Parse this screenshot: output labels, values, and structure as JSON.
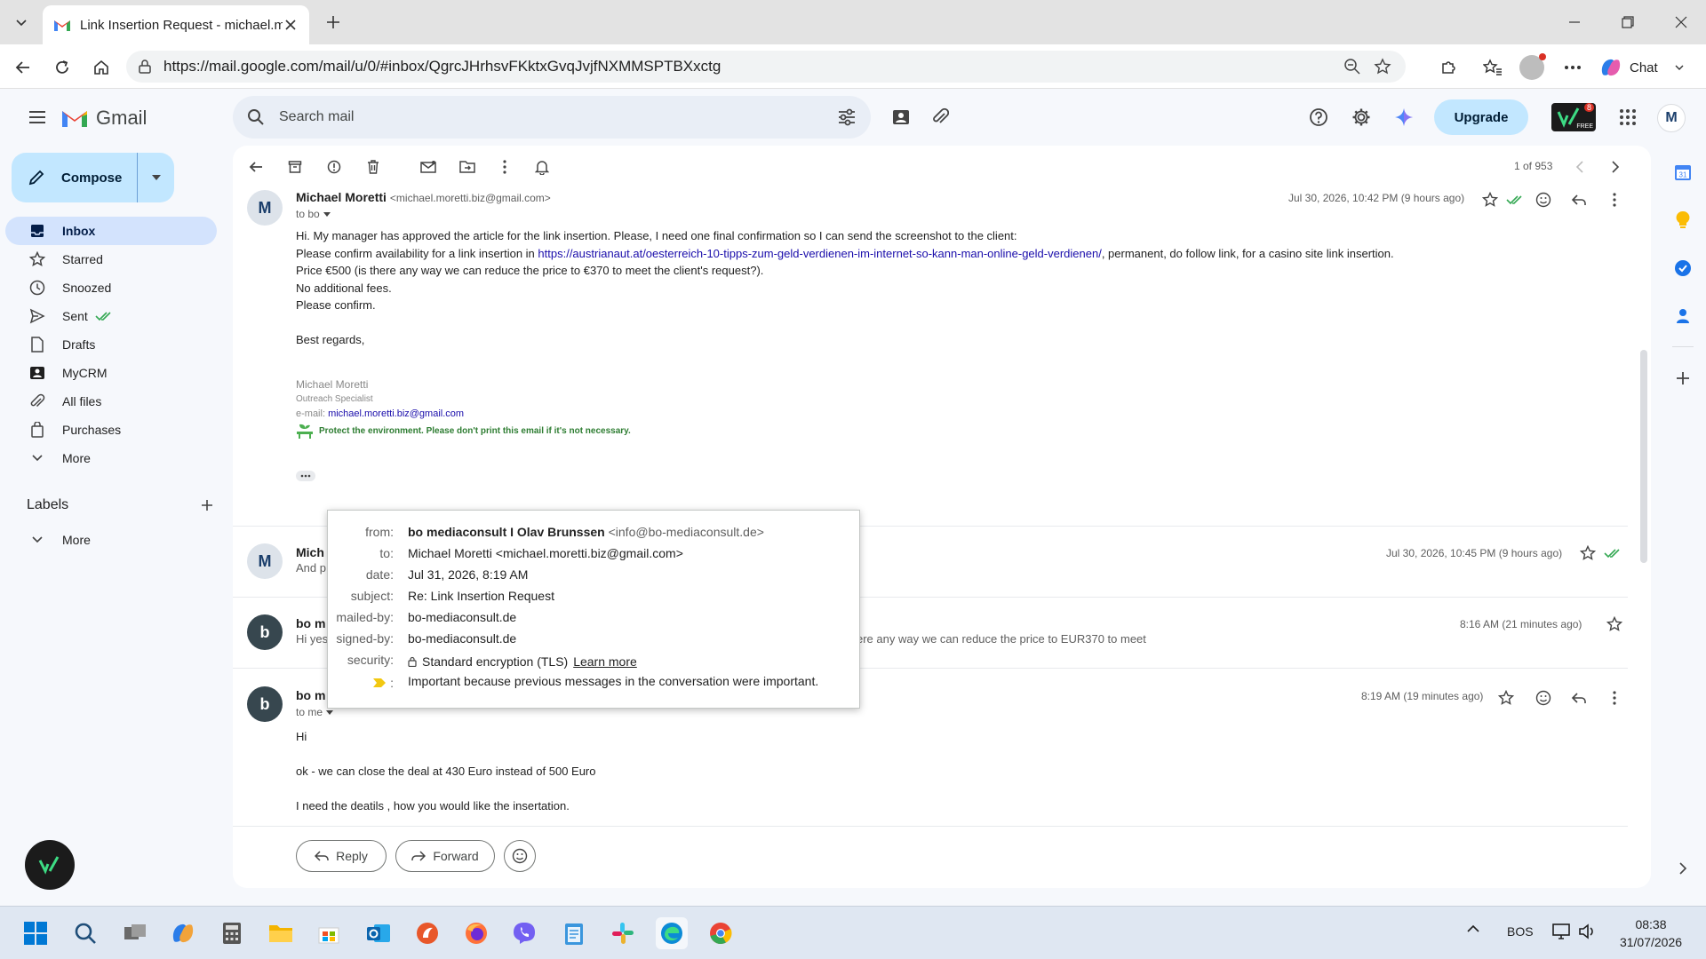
{
  "browser": {
    "tab_title": "Link Insertion Request - michael.m",
    "url": "https://mail.google.com/mail/u/0/#inbox/QgrcJHrhsvFKktxGvqJvjfNXMMSPTBXxctg",
    "chat_label": "Chat"
  },
  "gmail": {
    "brand": "Gmail",
    "search_placeholder": "Search mail",
    "upgrade_label": "Upgrade",
    "ext_badge_count": "8",
    "ext_badge_free": "FREE",
    "account_initial": "M"
  },
  "sidebar": {
    "compose_label": "Compose",
    "items": [
      {
        "label": "Inbox",
        "icon": "inbox-icon"
      },
      {
        "label": "Starred",
        "icon": "star-icon"
      },
      {
        "label": "Snoozed",
        "icon": "clock-icon"
      },
      {
        "label": "Sent",
        "icon": "send-icon"
      },
      {
        "label": "Drafts",
        "icon": "draft-icon"
      },
      {
        "label": "MyCRM",
        "icon": "contact-icon"
      },
      {
        "label": "All files",
        "icon": "paperclip-icon"
      },
      {
        "label": "Purchases",
        "icon": "bag-icon"
      },
      {
        "label": "More",
        "icon": "chevron-down-icon"
      }
    ],
    "labels_heading": "Labels",
    "labels_more": "More"
  },
  "toolbar": {
    "pager": "1 of 953"
  },
  "messages": {
    "m1": {
      "avatar": "M",
      "sender": "Michael Moretti",
      "email": "<michael.moretti.biz@gmail.com>",
      "to": "to bo",
      "date": "Jul 30, 2026, 10:42 PM (9 hours ago)",
      "line1": "Hi. My manager has approved the article for the link insertion. Please, I need one final confirmation so I can send the screenshot to the client:",
      "line2_pre": "Please confirm availability for a link insertion in ",
      "line2_link": "https://austrianaut.at/oesterreich-10-tipps-zum-geld-verdienen-im-internet-so-kann-man-online-geld-verdienen/",
      "line2_post": ", permanent, do follow link, for a casino site link insertion.",
      "line3": "Price  €500 (is there any way we can reduce the price to €370 to meet the client's request?).",
      "line4": "No additional fees.",
      "line5": "Please confirm.",
      "line6": "Best regards,",
      "sig_name": "Michael Moretti",
      "sig_title": "Outreach Specialist",
      "sig_email_label": "e-mail: ",
      "sig_email": "michael.moretti.biz@gmail.com",
      "sig_env": "Protect the environment. Please don't print this email if it's not necessary."
    },
    "m2": {
      "avatar": "M",
      "sender": "Mich",
      "snippet": "And p",
      "date": "Jul 30, 2026, 10:45 PM (9 hours ago)"
    },
    "m3": {
      "avatar": "b",
      "sender": "bo m",
      "snippet_left": "Hi yes",
      "snippet_right": "ere any way we can reduce the price to EUR370 to meet",
      "date": "8:16 AM (21 minutes ago)"
    },
    "m4": {
      "avatar": "b",
      "sender": "bo m",
      "to": "to me",
      "date": "8:19 AM (19 minutes ago)",
      "line1": "Hi",
      "line2": "ok - we can close the deal at 430 Euro instead of 500 Euro",
      "line3": "I need the deatils , how you would like the insertation."
    }
  },
  "details_popup": {
    "from_k": "from:",
    "from_name": "bo mediaconsult I Olav Brunssen",
    "from_email": "<info@bo-mediaconsult.de>",
    "to_k": "to:",
    "to_v": "Michael Moretti <michael.moretti.biz@gmail.com>",
    "date_k": "date:",
    "date_v": "Jul 31, 2026, 8:19 AM",
    "subject_k": "subject:",
    "subject_v": "Re: Link Insertion Request",
    "mailedby_k": "mailed-by:",
    "mailedby_v": "bo-mediaconsult.de",
    "signedby_k": "signed-by:",
    "signedby_v": "bo-mediaconsult.de",
    "security_k": "security:",
    "security_v": "Standard encryption (TLS)",
    "learn_more": "Learn more",
    "importance_k": ":",
    "importance_v": "Important because previous messages in the conversation were important."
  },
  "actions": {
    "reply": "Reply",
    "forward": "Forward"
  },
  "taskbar": {
    "lang": "BOS",
    "time": "08:38",
    "date": "31/07/2026"
  },
  "colors": {
    "accent": "#0b57d0",
    "compose_bg": "#c2e7ff",
    "active_nav": "#d3e3fd",
    "sig_green": "#2e7d32"
  }
}
